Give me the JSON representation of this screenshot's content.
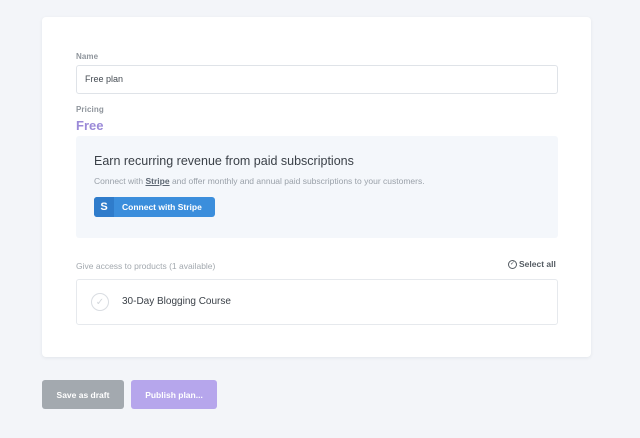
{
  "form": {
    "name_label": "Name",
    "name_value": "Free plan",
    "pricing_label": "Pricing",
    "price_value": "Free"
  },
  "stripe": {
    "title": "Earn recurring revenue from paid subscriptions",
    "desc_before": "Connect with ",
    "desc_link": "Stripe",
    "desc_after": " and offer monthly and annual paid subscriptions to your customers.",
    "button_icon": "S",
    "button_label": "Connect with Stripe"
  },
  "access": {
    "label": "Give access to products (1 available)",
    "select_all_label": "Select all",
    "products": [
      {
        "name": "30-Day Blogging Course",
        "selected": false
      }
    ]
  },
  "actions": {
    "draft_label": "Save as draft",
    "publish_label": "Publish plan..."
  },
  "colors": {
    "accent": "#9b8ad8",
    "stripe_blue": "#3b8edc",
    "publish_button": "#b6a6ec",
    "draft_button": "#a3a9af"
  },
  "icons": {
    "select_all": "check-circle-icon",
    "product_check": "check-circle-icon",
    "stripe": "stripe-logo-icon"
  }
}
